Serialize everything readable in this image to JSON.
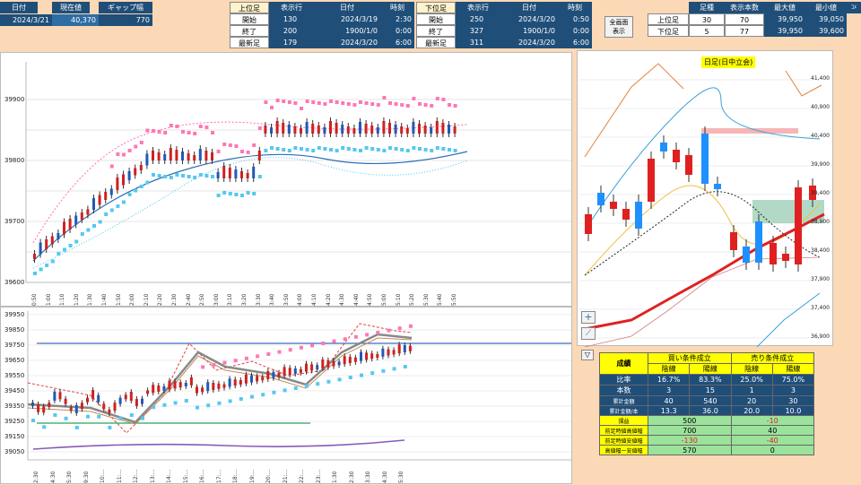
{
  "summary": {
    "headers": [
      "日付",
      "現在値",
      "ギャップ幅"
    ],
    "values": [
      "2024/3/21",
      "40,370",
      "770"
    ]
  },
  "upper": {
    "title": "上位足",
    "col_headers": [
      "表示行",
      "日付",
      "時刻"
    ],
    "rows": [
      {
        "label": "開始",
        "rows_shown": "130",
        "date": "2024/3/19",
        "time": "2:30"
      },
      {
        "label": "終了",
        "rows_shown": "200",
        "date": "1900/1/0",
        "time": "0:00"
      },
      {
        "label": "最新足",
        "rows_shown": "179",
        "date": "2024/3/20",
        "time": "6:00"
      }
    ]
  },
  "lower": {
    "title": "下位足",
    "col_headers": [
      "表示行",
      "日付",
      "時刻"
    ],
    "rows": [
      {
        "label": "開始",
        "rows_shown": "250",
        "date": "2024/3/20",
        "time": "0:50"
      },
      {
        "label": "終了",
        "rows_shown": "327",
        "date": "1900/1/0",
        "time": "0:00"
      },
      {
        "label": "最新足",
        "rows_shown": "311",
        "date": "2024/3/20",
        "time": "6:00"
      }
    ]
  },
  "fullscreen_button": "全画面\n表示",
  "range_table": {
    "headers": [
      "足種",
      "表示本数",
      "最大値",
      "最小値",
      "ｺﾒ"
    ],
    "rows": [
      {
        "label": "上位足",
        "kind": "30",
        "count": "70",
        "max": "39,950",
        "min": "39,050"
      },
      {
        "label": "下位足",
        "kind": "5",
        "count": "77",
        "max": "39,950",
        "min": "39,600"
      }
    ]
  },
  "chart_upper": {
    "y_ticks": [
      "39900",
      "39800",
      "39700",
      "39600"
    ],
    "x_ticks": [
      "0:50",
      "1:00",
      "1:10",
      "1:20",
      "1:30",
      "1:40",
      "1:50",
      "2:00",
      "2:10",
      "2:20",
      "2:30",
      "2:40",
      "2:50",
      "3:00",
      "3:10",
      "3:20",
      "3:30",
      "3:40",
      "3:50",
      "4:00",
      "4:10",
      "4:20",
      "4:30",
      "4:40",
      "4:50",
      "5:00",
      "5:10",
      "5:20",
      "5:30",
      "5:40",
      "5:50"
    ]
  },
  "chart_lower": {
    "y_ticks": [
      "39950",
      "39850",
      "39750",
      "39650",
      "39550",
      "39450",
      "39350",
      "39250",
      "39150",
      "39050"
    ],
    "x_ticks": [
      "2:30",
      "4:30",
      "5:30",
      "9:30",
      "10:...",
      "11:...",
      "12:...",
      "13:...",
      "14:...",
      "15:...",
      "16:...",
      "17:...",
      "18:...",
      "19:...",
      "20:...",
      "21:...",
      "22:...",
      "23:...",
      "1:30",
      "2:30",
      "3:30",
      "4:30",
      "5:30"
    ]
  },
  "chart_daily": {
    "title": "日足(日中立会)",
    "y_ticks": [
      "41,400",
      "40,900",
      "40,400",
      "39,900",
      "39,400",
      "38,900",
      "38,400",
      "37,900",
      "37,400",
      "36,900"
    ]
  },
  "stats": {
    "title": "成績",
    "buy_header": "買い条件成立",
    "sell_header": "売り条件成立",
    "sub_headers": [
      "陰線",
      "陽線",
      "陰線",
      "陽線"
    ],
    "rows": [
      {
        "label": "比率",
        "values": [
          "16.7%",
          "83.3%",
          "25.0%",
          "75.0%"
        ]
      },
      {
        "label": "本数",
        "values": [
          "3",
          "15",
          "1",
          "3"
        ]
      },
      {
        "label": "累計金額",
        "values": [
          "40",
          "540",
          "20",
          "30"
        ]
      },
      {
        "label": "累計金額/本",
        "values": [
          "13.3",
          "36.0",
          "20.0",
          "10.0"
        ]
      }
    ],
    "merged_rows": [
      {
        "label": "損益",
        "buy": "500",
        "sell": "-10"
      },
      {
        "label": "前足時値高値幅",
        "buy": "700",
        "sell": "40"
      },
      {
        "label": "前足時値安値幅",
        "buy": "-130",
        "sell": "-40"
      },
      {
        "label": "高値幅ー安値幅",
        "buy": "570",
        "sell": "0"
      }
    ]
  },
  "colors": {
    "header_bg": "#1f4e79",
    "accent": "#ffff00",
    "up": "#1e90ff",
    "down": "#e02020",
    "background": "#fcd9b6"
  }
}
